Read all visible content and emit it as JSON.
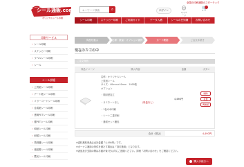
{
  "header": {
    "top_link": "全国の印刷通販のスターテック",
    "logo_text": "シール通販.com",
    "logo_sub": "オリジナルシール印刷",
    "search_placeholder": "キーワード検索",
    "login_label": "ログイン",
    "mypage_label": "マイページ",
    "icons": [
      "search-icon",
      "user-icon",
      "cart-icon"
    ]
  },
  "nav": [
    "シール印刷",
    "ステッカー印刷",
    "ご利用ガイド",
    "データ入稿",
    "シールの豆知識",
    "お問い合わせ"
  ],
  "sidebar": {
    "head": "印刷サービス",
    "items": [
      "シール印刷",
      "ステッカー印刷",
      "ラベルシール印刷",
      "シール"
    ],
    "section_title": "シール詳細",
    "sub_items": [
      "上質紙シール印刷",
      "アート紙シール印刷",
      "ミラーコートシール印刷",
      "合成紙シール印刷",
      "透明PETシール印刷",
      "銀PETシール印刷",
      "和紙シール印刷",
      "耐候シール印刷",
      "再剥離シール印刷",
      "強粘着シール印刷",
      "蓄光シール印刷"
    ]
  },
  "steps": [
    "商品を選ぶ",
    "仕様・数量・オプション選択",
    "カート確認",
    "ご注文手続き"
  ],
  "page_title": "現在のカゴの中",
  "section_head": "ご注文商品",
  "table_headers": [
    "商品イメージ",
    "購入内容",
    "金額",
    "ボタン"
  ],
  "item": {
    "name_lines": [
      "名称：オリジナルシール",
      "上質紙シール",
      "サイズ：40mm×40mm　1000枚",
      "オプション"
    ],
    "options": [
      {
        "label": "・開封型加工",
        "tag": ""
      },
      {
        "label": "・ラミネートなし",
        "tag": "（料金なし）"
      },
      {
        "label": "・1色のみ印刷",
        "tag": ""
      },
      {
        "label": "・シート二重印刷",
        "tag": ""
      },
      {
        "label": "・通常セット梱包",
        "tag": ""
      }
    ],
    "price": "4,490円",
    "buttons": [
      "削除",
      "変更",
      "再確認"
    ]
  },
  "total": {
    "label": "合計（税込）",
    "value": "4,490円"
  },
  "notes": [
    "※送料無料商品は合計金額「4,490円」です。",
    "※ボーナス適用の条件を満たす場合は「割引適用」となります。",
    "※返品及び交換の際はお届け後7日以内にご連絡ください。詳細「お問い合わせ」をご確認ください。"
  ],
  "checkout_label": "購入手続きへ"
}
